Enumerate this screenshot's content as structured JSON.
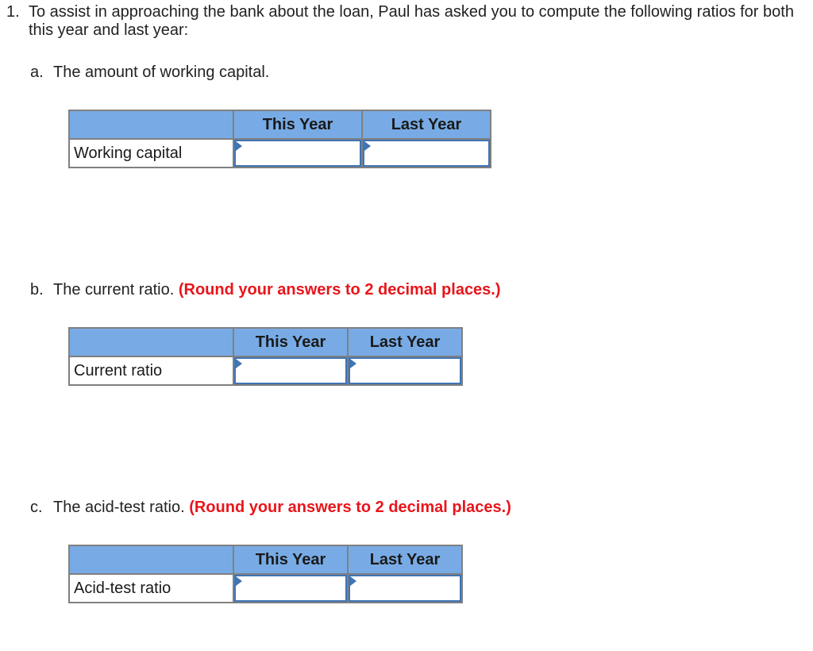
{
  "question": {
    "number": "1.",
    "text": "To assist in approaching the bank about the loan, Paul has asked you to compute the following ratios for both this year and last year:"
  },
  "parts": [
    {
      "letter": "a.",
      "prompt": "The amount of working capital.",
      "note": "",
      "columns": [
        "This Year",
        "Last Year"
      ],
      "row_label": "Working capital",
      "values": [
        "",
        ""
      ]
    },
    {
      "letter": "b.",
      "prompt": "The current ratio.",
      "note": "(Round your answers to 2 decimal places.)",
      "columns": [
        "This Year",
        "Last Year"
      ],
      "row_label": "Current ratio",
      "values": [
        "",
        ""
      ]
    },
    {
      "letter": "c.",
      "prompt": "The acid-test ratio.",
      "note": "(Round your answers to 2 decimal places.)",
      "columns": [
        "This Year",
        "Last Year"
      ],
      "row_label": "Acid-test ratio",
      "values": [
        "",
        ""
      ]
    }
  ],
  "colors": {
    "header_bg": "#78abe5",
    "input_border": "#3f74b5",
    "note_red": "#e8151b"
  }
}
